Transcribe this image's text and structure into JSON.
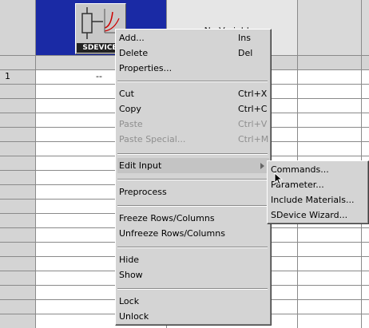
{
  "header": {
    "tool_label": "SDEVICE",
    "no_variables": "No Variables"
  },
  "grid": {
    "first_row_number": "1",
    "first_row_value": "--"
  },
  "context_menu": {
    "items": [
      {
        "label": "Add...",
        "shortcut": "Ins"
      },
      {
        "label": "Delete",
        "shortcut": "Del"
      },
      {
        "label": "Properties..."
      },
      {
        "label": "Cut",
        "shortcut": "Ctrl+X"
      },
      {
        "label": "Copy",
        "shortcut": "Ctrl+C"
      },
      {
        "label": "Paste",
        "shortcut": "Ctrl+V",
        "disabled": true
      },
      {
        "label": "Paste Special...",
        "shortcut": "Ctrl+M",
        "disabled": true
      },
      {
        "label": "Edit Input",
        "submenu": true
      },
      {
        "label": "Preprocess"
      },
      {
        "label": "Freeze Rows/Columns"
      },
      {
        "label": "Unfreeze Rows/Columns"
      },
      {
        "label": "Hide"
      },
      {
        "label": "Show"
      },
      {
        "label": "Lock"
      },
      {
        "label": "Unlock"
      }
    ]
  },
  "submenu": {
    "items": [
      {
        "label": "Commands..."
      },
      {
        "label": "Parameter..."
      },
      {
        "label": "Include Materials..."
      },
      {
        "label": "SDevice Wizard..."
      }
    ]
  }
}
